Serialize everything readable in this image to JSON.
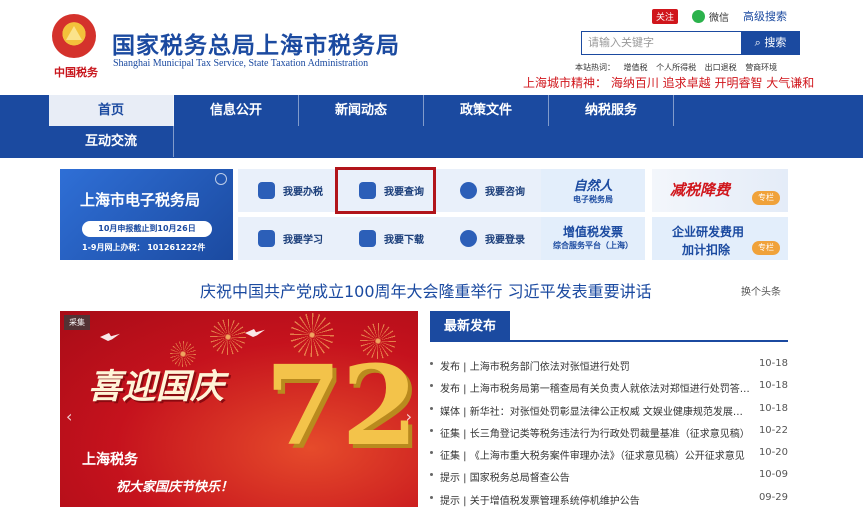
{
  "header": {
    "emblem_text": "中国税务",
    "title_cn": "国家税务总局上海市税务局",
    "title_en": "Shanghai Municipal Tax Service, State Taxation Administration",
    "care_label": "关注",
    "wechat_label": "微信",
    "advanced_search": "高级搜索",
    "search_placeholder": "请输入关键字",
    "search_button": "搜索",
    "hot_words_label": "本站热词：",
    "hot_words": [
      "增值税",
      "个人所得税",
      "出口退税",
      "营商环境"
    ],
    "spirit": "上海城市精神：  海纳百川  追求卓越  开明睿智  大气谦和"
  },
  "nav": {
    "items": [
      "首页",
      "信息公开",
      "新闻动态",
      "政策文件",
      "纳税服务",
      "互动交流"
    ]
  },
  "services": {
    "etax_title": "上海市电子税务局",
    "etax_deadline": "10月申报截止到10月26日",
    "etax_count": "1-9月网上办税：  101261222件",
    "items": [
      "我要办税",
      "我要查询",
      "我要咨询",
      "我要学习",
      "我要下载",
      "我要登录"
    ],
    "natural_title": "自然人",
    "natural_sub": "电子税务局",
    "reduce_title": "减税降费",
    "column_tag": "专栏",
    "vat_title": "增值税发票",
    "vat_sub": "综合服务平台（上海）",
    "rd_title1": "企业研发费用",
    "rd_title2": "加计扣除"
  },
  "headline": {
    "text": "庆祝中国共产党成立100周年大会隆重举行  习近平发表重要讲话",
    "swap": "换个头条"
  },
  "carousel": {
    "tag": "采集",
    "title": "喜迎国庆",
    "number": "72",
    "sub1": "上海税务",
    "sub2": "祝大家国庆节快乐！",
    "prev": "‹",
    "next": "›"
  },
  "news": {
    "tab": "最新发布",
    "items": [
      {
        "text": "发布 | 上海市税务部门依法对张恒进行处罚",
        "date": "10-18"
      },
      {
        "text": "发布 | 上海市税务局第一稽查局有关负责人就依法对郑恒进行处罚答记者问",
        "date": "10-18"
      },
      {
        "text": "媒体 | 新华社：对张恒处罚彰显法律公正权威 文娱业健康规范发展需……",
        "date": "10-18"
      },
      {
        "text": "征集 | 长三角登记类等税务违法行为行政处罚裁量基准（征求意见稿）",
        "date": "10-22"
      },
      {
        "text": "征集 | 《上海市重大税务案件审理办法》（征求意见稿）公开征求意见",
        "date": "10-20"
      },
      {
        "text": "提示 | 国家税务总局督查公告",
        "date": "10-09"
      },
      {
        "text": "提示 | 关于增值税发票管理系统停机维护公告",
        "date": "09-29"
      }
    ]
  },
  "colors": {
    "brand_blue": "#1b4aa0",
    "accent_red": "#d0161c"
  }
}
